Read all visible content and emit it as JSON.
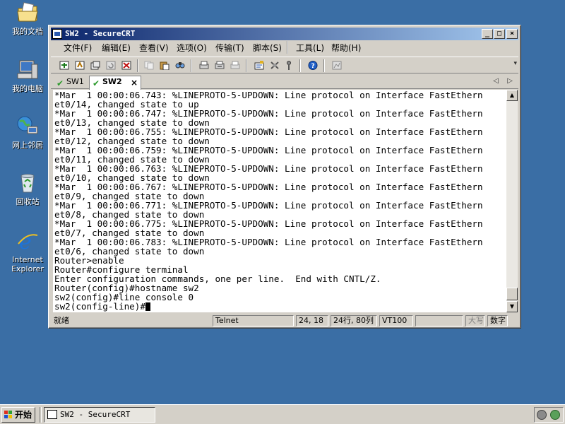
{
  "desktop": {
    "icons": [
      {
        "label": "我的文档",
        "icon": "my-documents-icon"
      },
      {
        "label": "我的电脑",
        "icon": "my-computer-icon"
      },
      {
        "label": "网上邻居",
        "icon": "network-places-icon"
      },
      {
        "label": "回收站",
        "icon": "recycle-bin-icon"
      },
      {
        "label": "Internet Explorer",
        "label_line1": "Internet",
        "label_line2": "Explorer",
        "icon": "internet-explorer-icon"
      }
    ]
  },
  "window": {
    "title": "SW2 - SecureCRT",
    "controls": {
      "minimize": "_",
      "maximize": "□",
      "close": "×"
    },
    "menu": [
      "文件(F)",
      "编辑(E)",
      "查看(V)",
      "选项(O)",
      "传输(T)",
      "脚本(S)",
      "工具(L)",
      "帮助(H)"
    ],
    "tabs": [
      {
        "label": "SW1",
        "active": false
      },
      {
        "label": "SW2",
        "active": true
      }
    ],
    "tab_nav": {
      "prev": "◁",
      "next": "▷"
    },
    "terminal_lines": [
      "*Mar  1 00:00:06.743: %LINEPROTO-5-UPDOWN: Line protocol on Interface FastEthern",
      "et0/14, changed state to up",
      "*Mar  1 00:00:06.747: %LINEPROTO-5-UPDOWN: Line protocol on Interface FastEthern",
      "et0/13, changed state to down",
      "*Mar  1 00:00:06.755: %LINEPROTO-5-UPDOWN: Line protocol on Interface FastEthern",
      "et0/12, changed state to down",
      "*Mar  1 00:00:06.759: %LINEPROTO-5-UPDOWN: Line protocol on Interface FastEthern",
      "et0/11, changed state to down",
      "*Mar  1 00:00:06.763: %LINEPROTO-5-UPDOWN: Line protocol on Interface FastEthern",
      "et0/10, changed state to down",
      "*Mar  1 00:00:06.767: %LINEPROTO-5-UPDOWN: Line protocol on Interface FastEthern",
      "et0/9, changed state to down",
      "*Mar  1 00:00:06.771: %LINEPROTO-5-UPDOWN: Line protocol on Interface FastEthern",
      "et0/8, changed state to down",
      "*Mar  1 00:00:06.775: %LINEPROTO-5-UPDOWN: Line protocol on Interface FastEthern",
      "et0/7, changed state to down",
      "*Mar  1 00:00:06.783: %LINEPROTO-5-UPDOWN: Line protocol on Interface FastEthern",
      "et0/6, changed state to down",
      "Router>enable",
      "Router#configure terminal",
      "Enter configuration commands, one per line.  End with CNTL/Z.",
      "Router(config)#hostname sw2",
      "sw2(config)#line console 0",
      "sw2(config-line)#"
    ],
    "status": {
      "ready": "就绪",
      "protocol": "Telnet",
      "cursor_pos": "24, 18",
      "size": "24行, 80列",
      "emulation": "VT100",
      "caps": "大写",
      "num": "数字"
    }
  },
  "taskbar": {
    "start_label": "开始",
    "tasks": [
      {
        "label": "SW2 - SecureCRT"
      }
    ]
  },
  "colors": {
    "desktop_bg": "#3a6ea5",
    "title_active_start": "#0a246a",
    "title_active_end": "#a6caf0",
    "face": "#d4d0c8"
  }
}
